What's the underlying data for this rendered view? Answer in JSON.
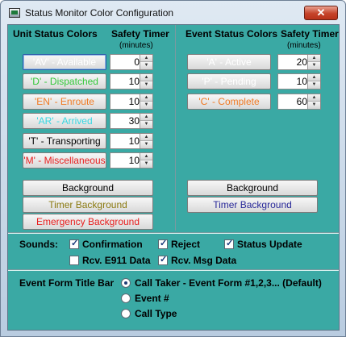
{
  "window": {
    "title": "Status Monitor Color Configuration",
    "close_glyph": "✕"
  },
  "unit_panel": {
    "header": "Unit Status Colors",
    "timer_header": "Safety Timer",
    "timer_sub": "(minutes)",
    "rows": [
      {
        "label": "'AV' - Available",
        "color": "#ffffff",
        "timer": "0"
      },
      {
        "label": "'D' - Dispatched",
        "color": "#35c83a",
        "timer": "10"
      },
      {
        "label": "'EN' - Enroute",
        "color": "#f07a24",
        "timer": "10"
      },
      {
        "label": "'AR' - Arrived",
        "color": "#39d7e2",
        "timer": "30"
      },
      {
        "label": "'T' - Transporting",
        "color": "#000000",
        "timer": "10"
      },
      {
        "label": "'M' - Miscellaneous",
        "color": "#e82020",
        "timer": "10"
      }
    ],
    "background_btn": "Background",
    "timer_background_btn": "Timer Background",
    "timer_background_color": "#8c7b12",
    "emergency_background_btn": "Emergency Background",
    "emergency_background_color": "#e82020"
  },
  "event_panel": {
    "header": "Event Status Colors",
    "timer_header": "Safety Timer",
    "timer_sub": "(minutes)",
    "rows": [
      {
        "label": "'A' - Active",
        "color": "#ffffff",
        "timer": "20"
      },
      {
        "label": "'P' - Pending",
        "color": "#ffffff",
        "timer": "10"
      },
      {
        "label": "'C' - Complete",
        "color": "#f07a24",
        "timer": "60"
      }
    ],
    "background_btn": "Background",
    "timer_background_btn": "Timer Background",
    "timer_background_color": "#2a2a9a"
  },
  "sounds": {
    "label": "Sounds:",
    "options": [
      {
        "label": "Confirmation",
        "checked": true
      },
      {
        "label": "Reject",
        "checked": true
      },
      {
        "label": "Status Update",
        "checked": true
      },
      {
        "label": "Rcv. E911 Data",
        "checked": false
      },
      {
        "label": "Rcv. Msg Data",
        "checked": true
      }
    ]
  },
  "title_bar": {
    "label": "Event Form Title Bar",
    "options": [
      {
        "label": "Call Taker - Event Form #1,2,3... (Default)",
        "selected": true
      },
      {
        "label": "Event #",
        "selected": false
      },
      {
        "label": "Call Type",
        "selected": false
      }
    ]
  }
}
